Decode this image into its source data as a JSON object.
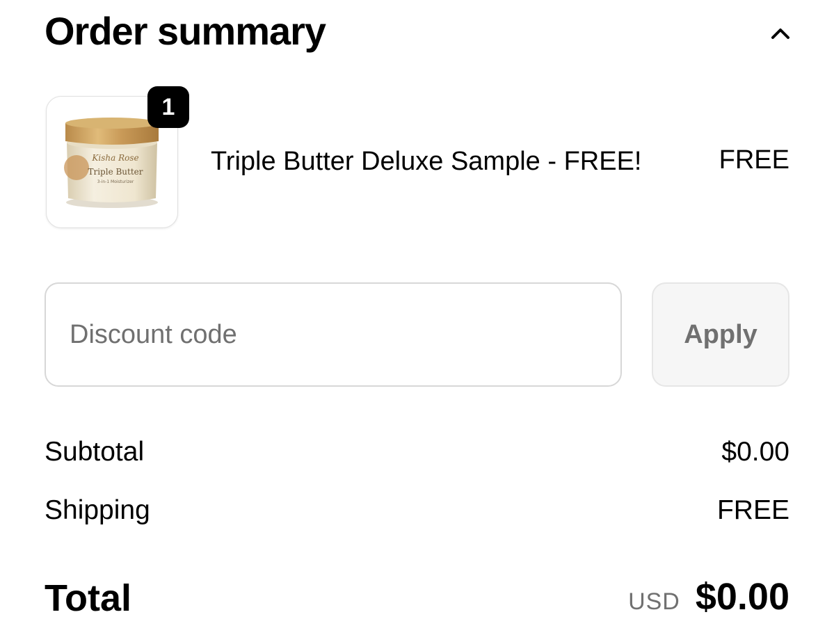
{
  "header": {
    "title": "Order summary",
    "toggle_icon": "chevron-up-icon"
  },
  "line_item": {
    "quantity": "1",
    "name": "Triple Butter Deluxe Sample - FREE!",
    "price": "FREE",
    "image": {
      "brand_text": "Kisha Rose",
      "product_text": "Triple Butter",
      "detail_text": "3-in-1 Moisturizer"
    }
  },
  "discount": {
    "placeholder": "Discount code",
    "value": "",
    "apply_label": "Apply"
  },
  "summary": {
    "subtotal_label": "Subtotal",
    "subtotal_value": "$0.00",
    "shipping_label": "Shipping",
    "shipping_value": "FREE",
    "total_label": "Total",
    "currency": "USD",
    "total_value": "$0.00"
  },
  "colors": {
    "text": "#000000",
    "muted": "#707070",
    "border": "#d7d7d7",
    "button_bg": "#f6f6f6",
    "badge_bg": "#000000"
  }
}
